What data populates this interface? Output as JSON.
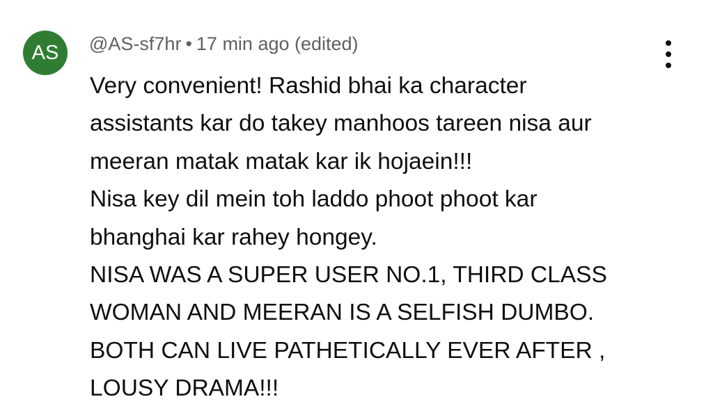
{
  "comment": {
    "avatar_initials": "AS",
    "avatar_color": "#2e7d32",
    "author": "@AS-sf7hr",
    "separator": "•",
    "timestamp": "17 min ago (edited)",
    "body_lines": [
      "Very convenient! Rashid bhai ka character",
      "assistants kar do takey manhoos tareen nisa aur",
      "meeran matak matak kar ik hojaein!!!",
      "Nisa key dil mein toh laddo phoot phoot kar",
      "bhanghai kar rahey hongey.",
      "NISA WAS A SUPER USER NO.1, THIRD CLASS",
      "WOMAN AND MEERAN IS A SELFISH DUMBO.",
      "BOTH CAN LIVE PATHETICALLY EVER AFTER ,",
      "LOUSY DRAMA!!!"
    ],
    "menu_icon": "more-vertical-icon"
  }
}
